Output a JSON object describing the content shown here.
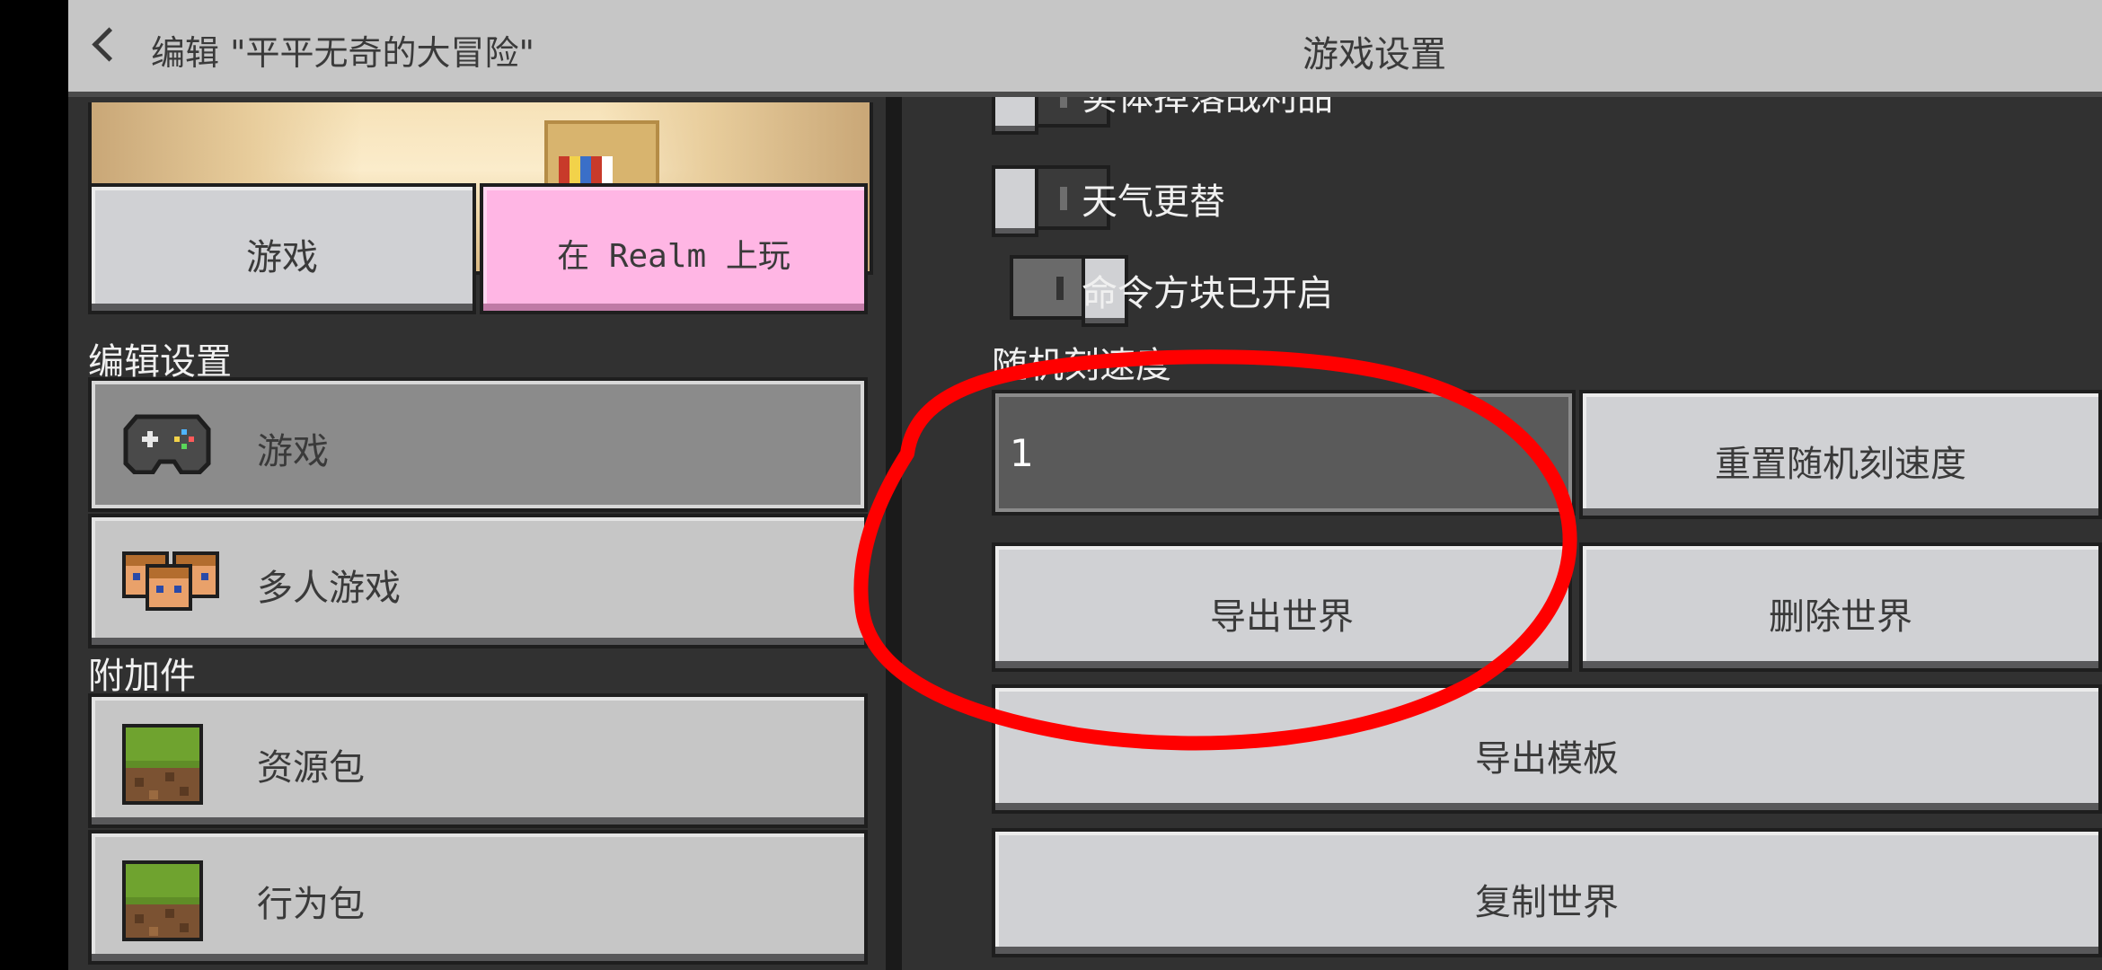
{
  "header": {
    "back_title": "编辑 \"平平无奇的大冒险\"",
    "title": "游戏设置"
  },
  "left": {
    "tabs": {
      "game": "游戏",
      "realm": "在 Realm 上玩"
    },
    "edit_settings_title": "编辑设置",
    "nav": [
      {
        "label": "游戏",
        "icon": "controller-icon",
        "selected": true
      },
      {
        "label": "多人游戏",
        "icon": "players-icon",
        "selected": false
      }
    ],
    "addons_title": "附加件",
    "addons": [
      {
        "label": "资源包",
        "icon": "grass-block-icon"
      },
      {
        "label": "行为包",
        "icon": "grass-block-icon"
      }
    ]
  },
  "right": {
    "toggles": [
      {
        "label": "实体掉落战利品",
        "state": "off"
      },
      {
        "label": "天气更替",
        "state": "off"
      },
      {
        "label": "命令方块已开启",
        "state": "on"
      }
    ],
    "tick_speed": {
      "label": "随机刻速度",
      "value": "1"
    },
    "buttons": {
      "reset_tick": "重置随机刻速度",
      "export_world": "导出世界",
      "delete_world": "删除世界",
      "export_template": "导出模板",
      "copy_world": "复制世界"
    }
  },
  "colors": {
    "realm_tab": "#ffb6e4",
    "annotation": "#ff0000",
    "panel_bg": "#313131",
    "header_bg": "#c6c6c6"
  }
}
